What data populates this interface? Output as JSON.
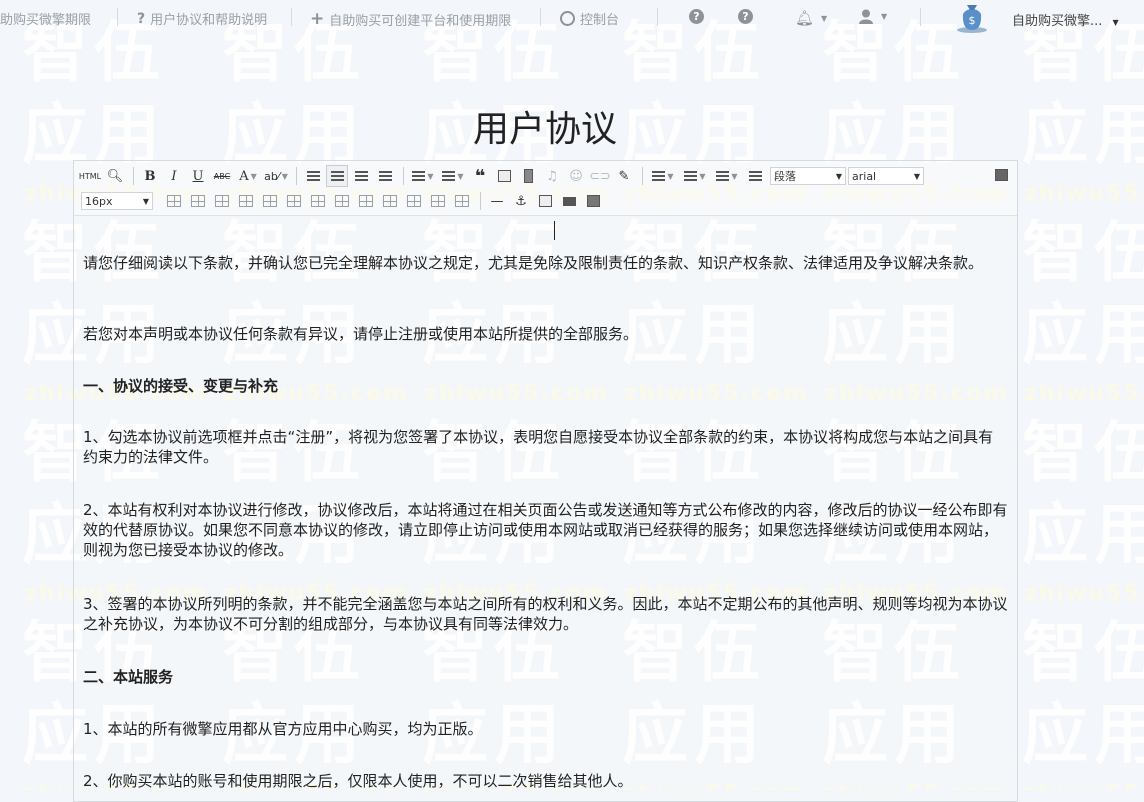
{
  "nav": {
    "items": [
      {
        "label": "助购买微擎期限",
        "icon": "none"
      },
      {
        "label": "用户协议和帮助说明",
        "icon": "question-icon"
      },
      {
        "label": "自助购买可创建平台和使用期限",
        "icon": "plus-icon"
      },
      {
        "label": "控制台",
        "icon": "gauge-icon"
      }
    ],
    "help_icons": [
      "question-icon",
      "question-icon"
    ],
    "notification_icon": "bell-icon",
    "user_icon": "user-icon",
    "account_name": "自助购买微擎..."
  },
  "watermark": {
    "big_text": "智伍\n应用",
    "url": "zhiwu55.com",
    "color": "#ffffff"
  },
  "page": {
    "title": "用户协议"
  },
  "editor": {
    "toolbar": {
      "html_label": "HTML",
      "bold": "B",
      "italic": "I",
      "underline": "U",
      "strike": "ABC",
      "font_color": "A",
      "paragraph_select": "段落",
      "font_select": "arial",
      "size_select": "16px"
    },
    "paragraphs": [
      {
        "text": "请您仔细阅读以下条款，并确认您已完全理解本协议之规定，尤其是免除及限制责任的条款、知识产权条款、法律适用及争议解决条款。",
        "bold": false
      },
      {
        "text": "若您对本声明或本协议任何条款有异议，请停止注册或使用本站所提供的全部服务。",
        "bold": false
      },
      {
        "text": "一、协议的接受、变更与补充",
        "bold": true
      },
      {
        "text": "1、勾选本协议前选项框并点击“注册”，将视为您签署了本协议，表明您自愿接受本协议全部条款的约束，本协议将构成您与本站之间具有约束力的法律文件。",
        "bold": false
      },
      {
        "text": "2、本站有权利对本协议进行修改，协议修改后，本站将通过在相关页面公告或发送通知等方式公布修改的内容，修改后的协议一经公布即有效的代替原协议。如果您不同意本协议的修改，请立即停止访问或使用本网站或取消已经获得的服务；如果您选择继续访问或使用本网站，则视为您已接受本协议的修改。",
        "bold": false
      },
      {
        "text": "3、签署的本协议所列明的条款，并不能完全涵盖您与本站之间所有的权利和义务。因此，本站不定期公布的其他声明、规则等均视为本协议之补充协议，为本协议不可分割的组成部分，与本协议具有同等法律效力。",
        "bold": false
      },
      {
        "text": "二、本站服务",
        "bold": true
      },
      {
        "text": "1、本站的所有微擎应用都从官方应用中心购买，均为正版。",
        "bold": false
      },
      {
        "text": "2、你购买本站的账号和使用期限之后，仅限本人使用，不可以二次销售给其他人。",
        "bold": false
      }
    ]
  }
}
